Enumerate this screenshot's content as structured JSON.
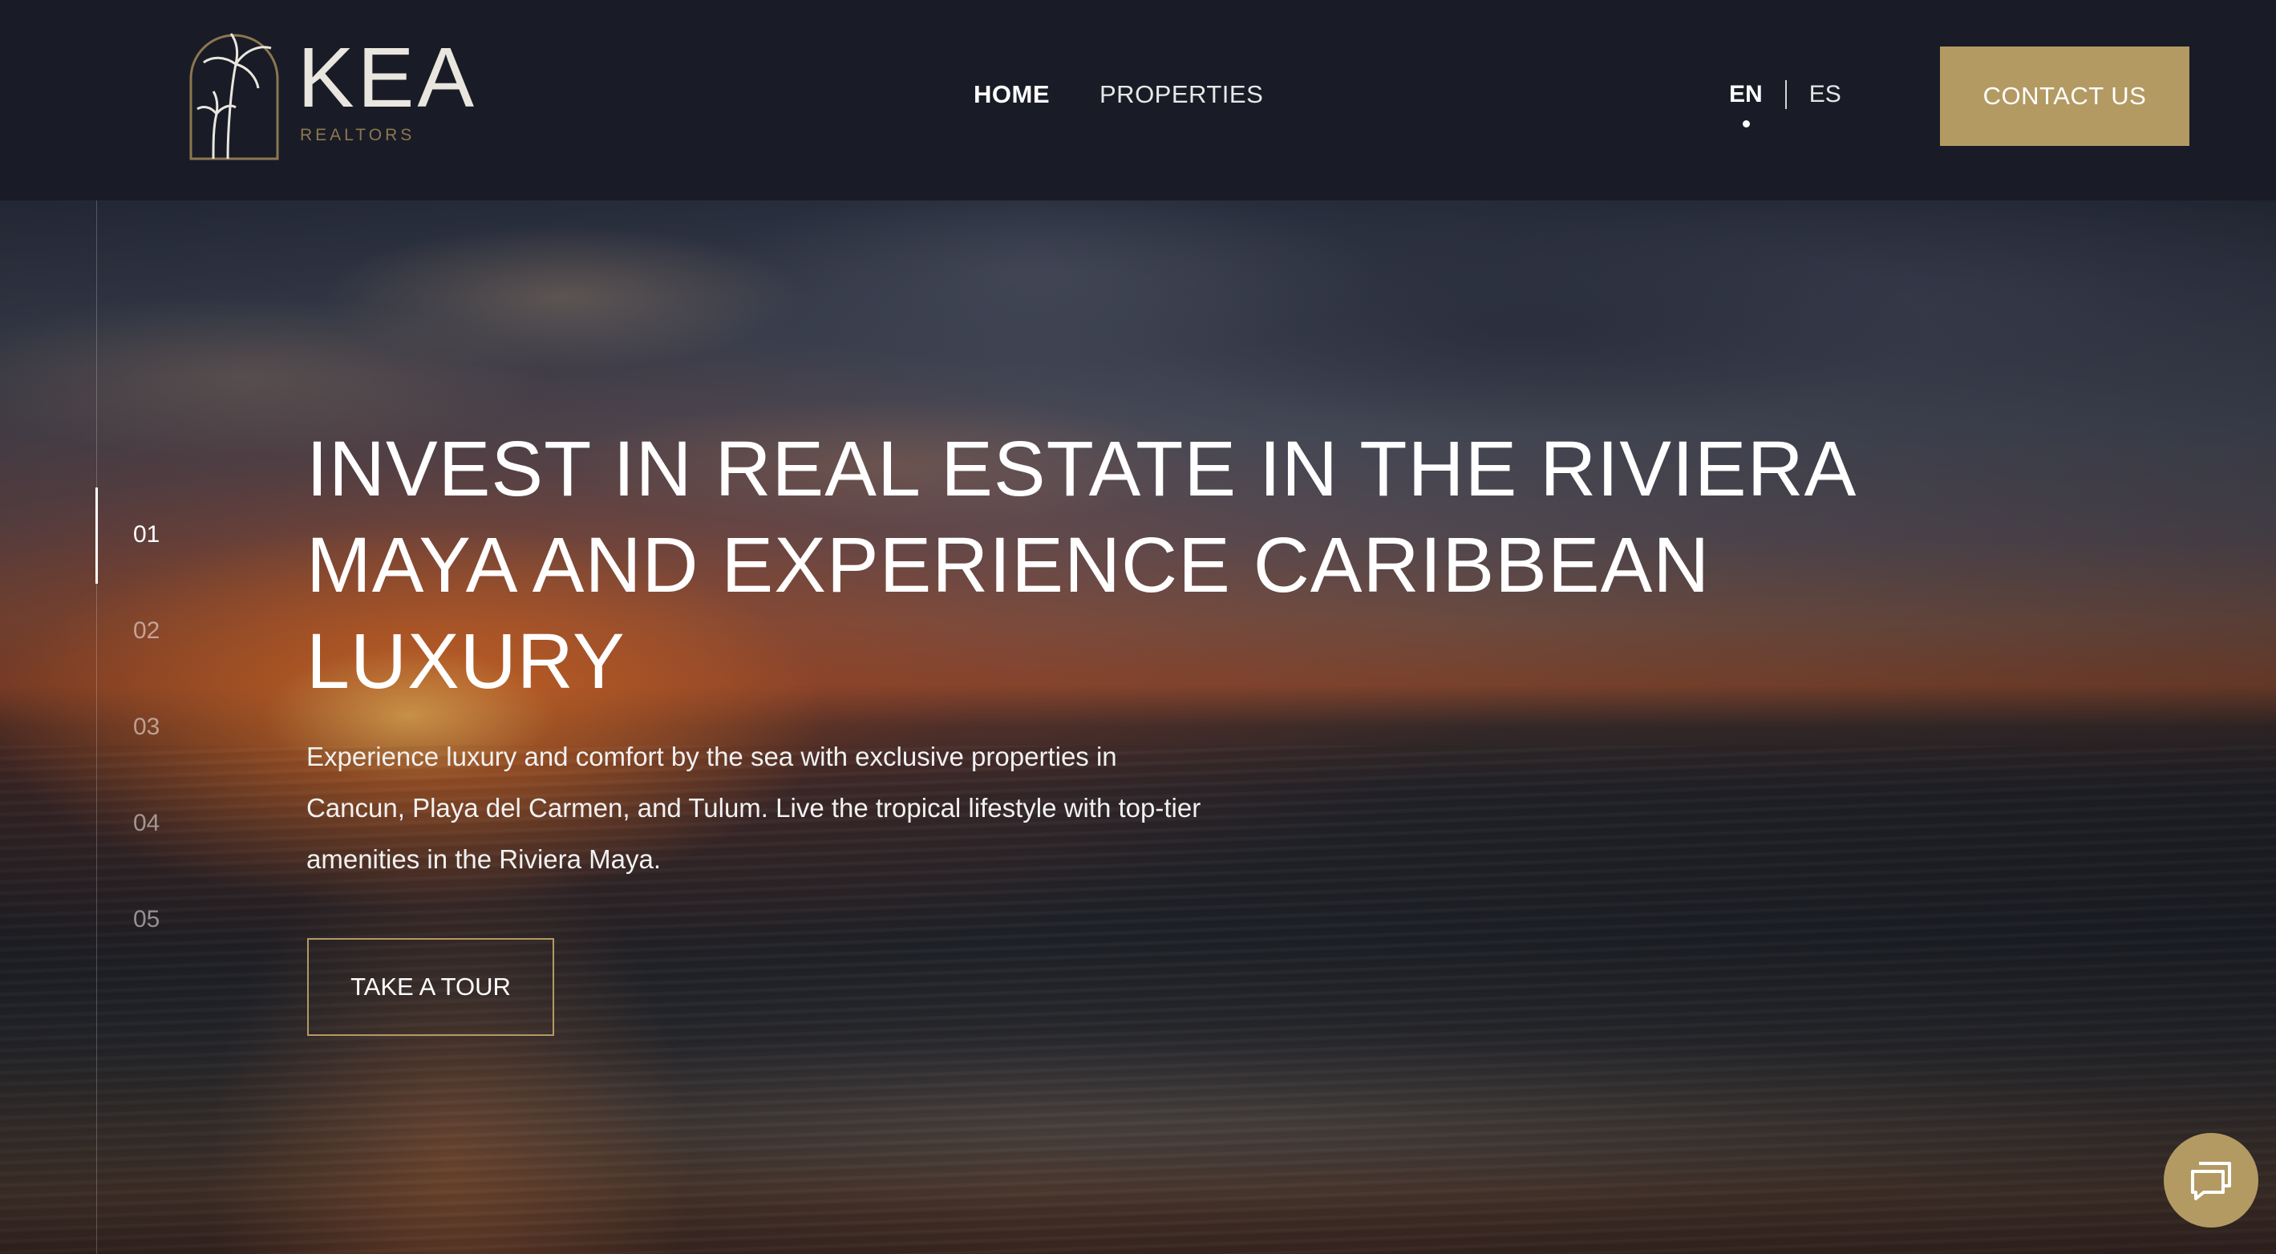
{
  "brand": {
    "name": "KEA",
    "subtitle": "REALTORS"
  },
  "nav": {
    "items": [
      {
        "label": "HOME",
        "active": true
      },
      {
        "label": "PROPERTIES",
        "active": false
      }
    ]
  },
  "language": {
    "options": [
      {
        "label": "EN",
        "active": true
      },
      {
        "label": "ES",
        "active": false
      }
    ]
  },
  "header": {
    "contact_label": "CONTACT US"
  },
  "hero": {
    "title": "INVEST IN REAL ESTATE IN THE RIVIERA MAYA AND EXPERIENCE CARIBBEAN LUXURY",
    "description": "Experience luxury and comfort by the sea with exclusive properties in Cancun, Playa del Carmen, and Tulum. Live the tropical lifestyle with top-tier amenities in the Riviera Maya.",
    "cta_label": "TAKE A TOUR"
  },
  "slider": {
    "active_index": 0,
    "numbers": [
      "01",
      "02",
      "03",
      "04",
      "05"
    ]
  },
  "colors": {
    "accent": "#b39a63",
    "header_bg": "#191c26"
  },
  "icons": {
    "chat": "chat-bubbles-icon",
    "logo": "palm-arch-logo-icon"
  }
}
